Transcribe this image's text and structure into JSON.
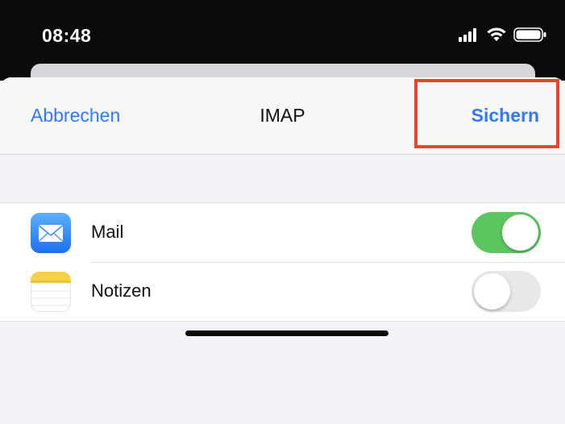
{
  "status_bar": {
    "time": "08:48",
    "icons": [
      "signal-icon",
      "wifi-icon",
      "battery-icon"
    ]
  },
  "nav": {
    "cancel_label": "Abbrechen",
    "title": "IMAP",
    "save_label": "Sichern"
  },
  "highlight_color": "#e8442f",
  "accent_color": "#3478f6",
  "accounts": [
    {
      "label": "Mail",
      "icon": "mail-app-icon",
      "enabled": true
    },
    {
      "label": "Notizen",
      "icon": "notes-app-icon",
      "enabled": false
    }
  ]
}
